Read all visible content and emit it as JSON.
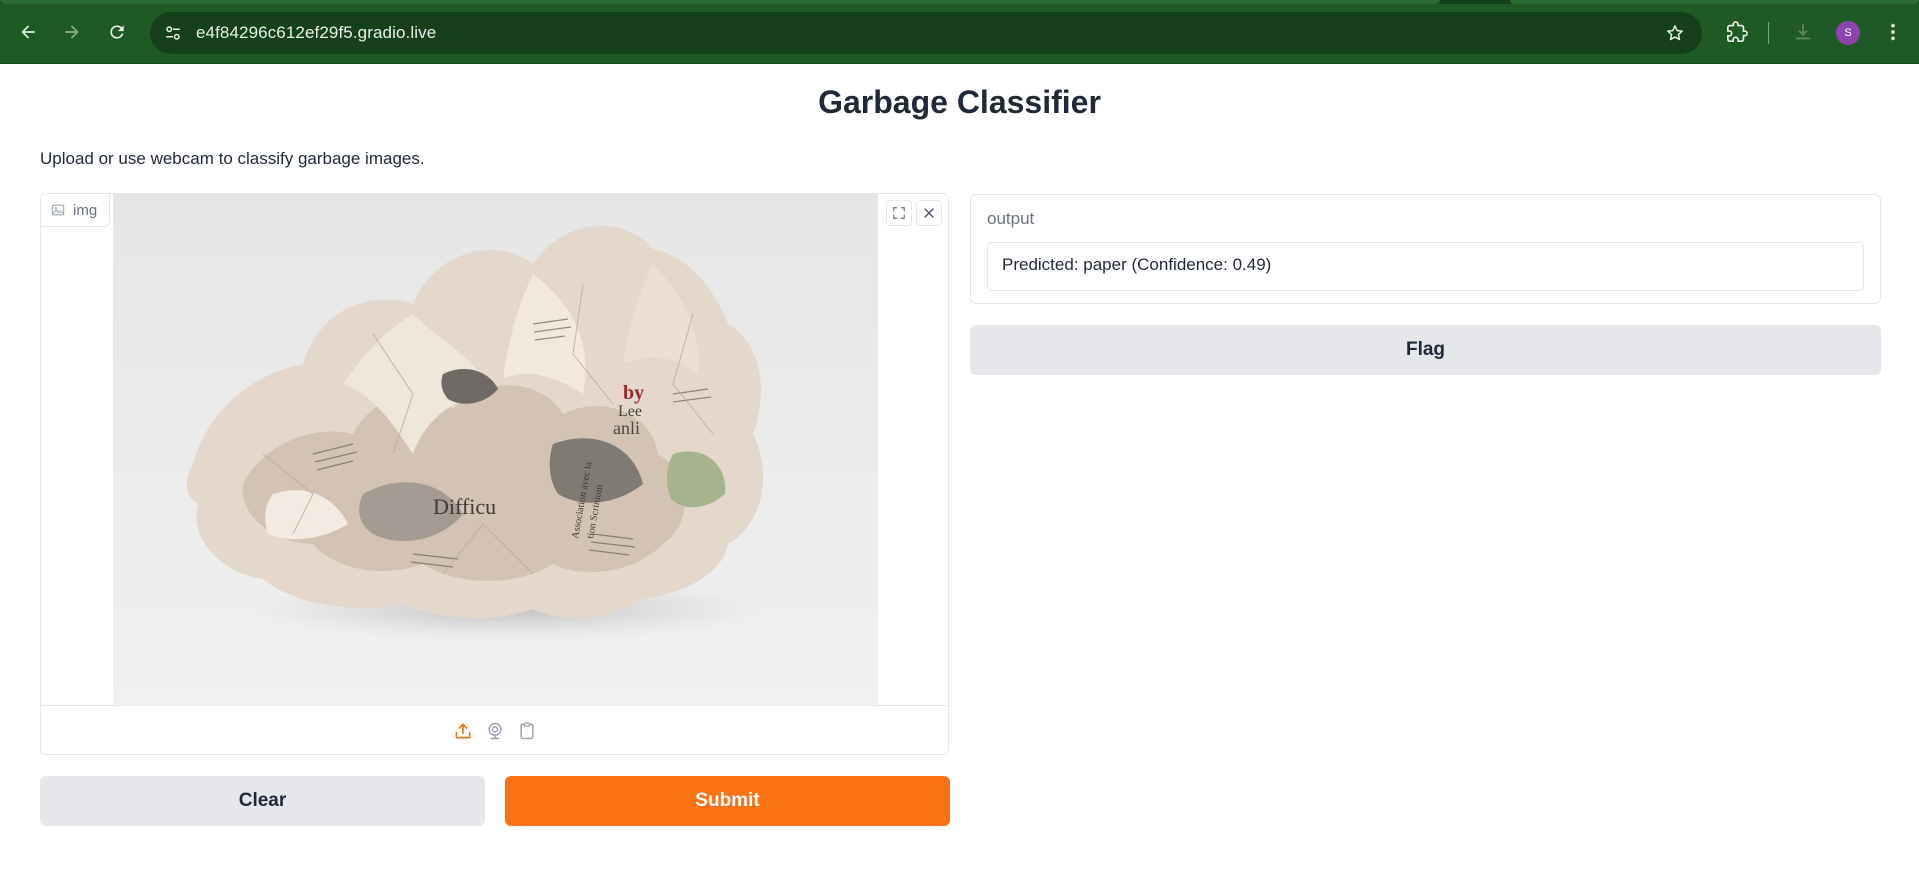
{
  "browser": {
    "url": "e4f84296c612ef29f5.gradio.live",
    "avatar_initial": "S",
    "frame_color": "#1f5a26"
  },
  "app": {
    "title": "Garbage Classifier",
    "description": "Upload or use webcam to classify garbage images.",
    "accent_color": "#f97316"
  },
  "image_input": {
    "label": "img",
    "toolbar_icons": [
      "fullscreen-icon",
      "close-icon"
    ],
    "source_icons": [
      "upload-icon",
      "webcam-icon",
      "clipboard-icon"
    ],
    "image_text": [
      "by",
      "Lee",
      "anli",
      "Difficu",
      "Association avec la",
      "tion Scrinium"
    ]
  },
  "output": {
    "label": "output",
    "value": "Predicted: paper (Confidence: 0.49)"
  },
  "buttons": {
    "flag": "Flag",
    "clear": "Clear",
    "submit": "Submit"
  }
}
